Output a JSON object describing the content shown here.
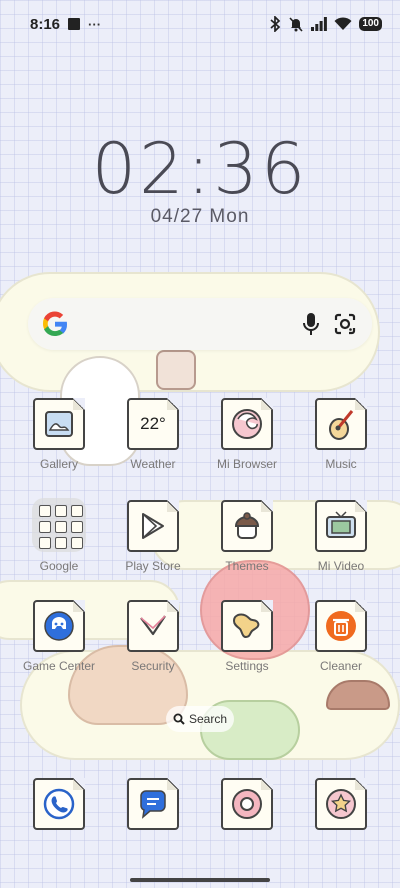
{
  "status_bar": {
    "time": "8:16",
    "more": "···",
    "battery": "100"
  },
  "lockscreen": {
    "clock": "02:36",
    "date": "04/27 Mon"
  },
  "search_widget": {
    "google_letter": "G"
  },
  "apps": [
    {
      "label": "Gallery",
      "icon": "gallery-icon"
    },
    {
      "label": "Weather",
      "icon": "weather-icon",
      "temp": "22°"
    },
    {
      "label": "Mi Browser",
      "icon": "browser-icon"
    },
    {
      "label": "Music",
      "icon": "music-icon"
    },
    {
      "label": "Google",
      "icon": "google-folder-icon"
    },
    {
      "label": "Play Store",
      "icon": "play-store-icon"
    },
    {
      "label": "Themes",
      "icon": "themes-icon"
    },
    {
      "label": "Mi Video",
      "icon": "video-icon"
    },
    {
      "label": "Game Center",
      "icon": "game-icon"
    },
    {
      "label": "Security",
      "icon": "security-icon"
    },
    {
      "label": "Settings",
      "icon": "settings-icon"
    },
    {
      "label": "Cleaner",
      "icon": "trash-icon"
    }
  ],
  "home_search": {
    "label": "Search"
  },
  "dock": [
    {
      "icon": "phone-icon"
    },
    {
      "icon": "messages-icon"
    },
    {
      "icon": "chrome-icon"
    },
    {
      "icon": "camera-icon"
    }
  ],
  "colors": {
    "background": "#eceef9",
    "icon_paper": "#fffdf3",
    "outline": "#444444",
    "game_blue": "#2f6fdc",
    "cleaner_orange": "#f06a1f"
  }
}
